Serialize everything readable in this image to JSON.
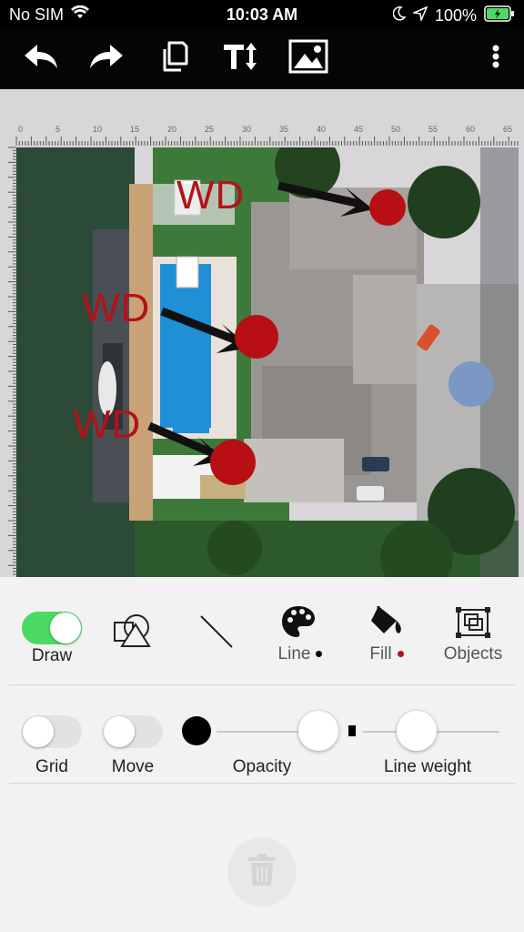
{
  "status_bar": {
    "carrier": "No SIM",
    "time": "10:03 AM",
    "battery_percent": "100%"
  },
  "toolbar": {
    "icons": [
      "undo-icon",
      "redo-icon",
      "copy-icon",
      "text-size-icon",
      "image-icon",
      "more-icon"
    ]
  },
  "ruler": {
    "top_labels": [
      "0",
      "5",
      "10",
      "15",
      "20",
      "25",
      "30",
      "35",
      "40",
      "45",
      "50",
      "55",
      "60",
      "65"
    ]
  },
  "canvas": {
    "annotations": [
      "WD",
      "WD",
      "WD"
    ],
    "annotation_color": "#b3121a"
  },
  "tools": {
    "draw_label": "Draw",
    "line_label": "Line",
    "fill_label": "Fill",
    "objects_label": "Objects",
    "line_color": "#000000",
    "fill_color": "#b3121a"
  },
  "settings": {
    "grid_label": "Grid",
    "move_label": "Move",
    "opacity_label": "Opacity",
    "line_weight_label": "Line weight"
  },
  "colors": {
    "toggle_on": "#4cd964",
    "toolbar_bg": "#050505"
  }
}
